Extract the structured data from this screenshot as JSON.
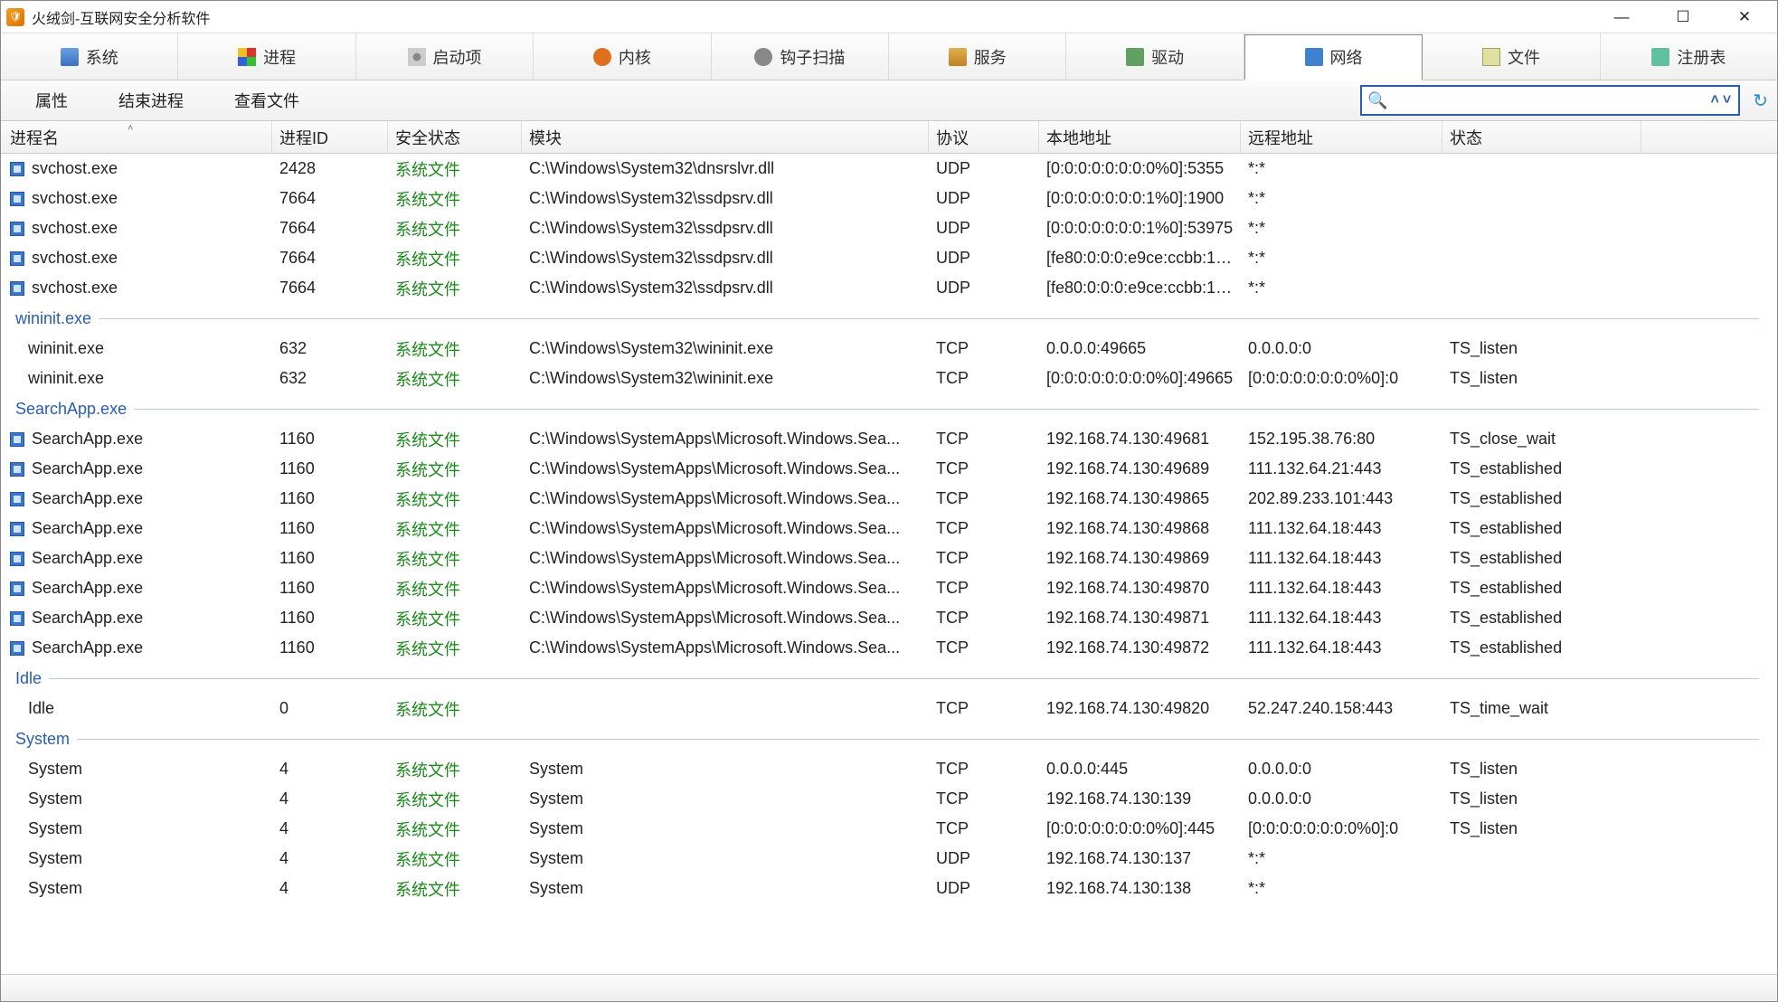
{
  "window": {
    "title": "火绒剑-互联网安全分析软件"
  },
  "menubar": {
    "tabs": [
      {
        "label": "系统",
        "icon": "mi-sys"
      },
      {
        "label": "进程",
        "icon": "mi-proc"
      },
      {
        "label": "启动项",
        "icon": "mi-start"
      },
      {
        "label": "内核",
        "icon": "mi-kernel"
      },
      {
        "label": "钩子扫描",
        "icon": "mi-hook"
      },
      {
        "label": "服务",
        "icon": "mi-svc"
      },
      {
        "label": "驱动",
        "icon": "mi-drv"
      },
      {
        "label": "网络",
        "icon": "mi-net",
        "active": true
      },
      {
        "label": "文件",
        "icon": "mi-file"
      },
      {
        "label": "注册表",
        "icon": "mi-reg"
      }
    ]
  },
  "toolbar": {
    "buttons": [
      "属性",
      "结束进程",
      "查看文件"
    ],
    "search_value": ""
  },
  "columns": [
    "进程名",
    "进程ID",
    "安全状态",
    "模块",
    "协议",
    "本地地址",
    "远程地址",
    "状态"
  ],
  "rows": [
    {
      "type": "row",
      "indent": false,
      "proc": "svchost.exe",
      "pid": "2428",
      "sec": "系统文件",
      "mod": "C:\\Windows\\System32\\dnsrslvr.dll",
      "proto": "UDP",
      "local": "[0:0:0:0:0:0:0:0%0]:5355",
      "remote": "*:*",
      "state": ""
    },
    {
      "type": "row",
      "indent": false,
      "proc": "svchost.exe",
      "pid": "7664",
      "sec": "系统文件",
      "mod": "C:\\Windows\\System32\\ssdpsrv.dll",
      "proto": "UDP",
      "local": "[0:0:0:0:0:0:0:1%0]:1900",
      "remote": "*:*",
      "state": ""
    },
    {
      "type": "row",
      "indent": false,
      "proc": "svchost.exe",
      "pid": "7664",
      "sec": "系统文件",
      "mod": "C:\\Windows\\System32\\ssdpsrv.dll",
      "proto": "UDP",
      "local": "[0:0:0:0:0:0:0:1%0]:53975",
      "remote": "*:*",
      "state": ""
    },
    {
      "type": "row",
      "indent": false,
      "proc": "svchost.exe",
      "pid": "7664",
      "sec": "系统文件",
      "mod": "C:\\Windows\\System32\\ssdpsrv.dll",
      "proto": "UDP",
      "local": "[fe80:0:0:0:e9ce:ccbb:1c...",
      "remote": "*:*",
      "state": ""
    },
    {
      "type": "row",
      "indent": false,
      "proc": "svchost.exe",
      "pid": "7664",
      "sec": "系统文件",
      "mod": "C:\\Windows\\System32\\ssdpsrv.dll",
      "proto": "UDP",
      "local": "[fe80:0:0:0:e9ce:ccbb:1c...",
      "remote": "*:*",
      "state": ""
    },
    {
      "type": "group",
      "label": "wininit.exe"
    },
    {
      "type": "row",
      "indent": true,
      "proc": "wininit.exe",
      "pid": "632",
      "sec": "系统文件",
      "mod": "C:\\Windows\\System32\\wininit.exe",
      "proto": "TCP",
      "local": "0.0.0.0:49665",
      "remote": "0.0.0.0:0",
      "state": "TS_listen"
    },
    {
      "type": "row",
      "indent": true,
      "proc": "wininit.exe",
      "pid": "632",
      "sec": "系统文件",
      "mod": "C:\\Windows\\System32\\wininit.exe",
      "proto": "TCP",
      "local": "[0:0:0:0:0:0:0:0%0]:49665",
      "remote": "[0:0:0:0:0:0:0:0%0]:0",
      "state": "TS_listen"
    },
    {
      "type": "group",
      "label": "SearchApp.exe"
    },
    {
      "type": "row",
      "indent": false,
      "proc": "SearchApp.exe",
      "pid": "1160",
      "sec": "系统文件",
      "mod": "C:\\Windows\\SystemApps\\Microsoft.Windows.Sea...",
      "proto": "TCP",
      "local": "192.168.74.130:49681",
      "remote": "152.195.38.76:80",
      "state": "TS_close_wait"
    },
    {
      "type": "row",
      "indent": false,
      "proc": "SearchApp.exe",
      "pid": "1160",
      "sec": "系统文件",
      "mod": "C:\\Windows\\SystemApps\\Microsoft.Windows.Sea...",
      "proto": "TCP",
      "local": "192.168.74.130:49689",
      "remote": "111.132.64.21:443",
      "state": "TS_established"
    },
    {
      "type": "row",
      "indent": false,
      "proc": "SearchApp.exe",
      "pid": "1160",
      "sec": "系统文件",
      "mod": "C:\\Windows\\SystemApps\\Microsoft.Windows.Sea...",
      "proto": "TCP",
      "local": "192.168.74.130:49865",
      "remote": "202.89.233.101:443",
      "state": "TS_established"
    },
    {
      "type": "row",
      "indent": false,
      "proc": "SearchApp.exe",
      "pid": "1160",
      "sec": "系统文件",
      "mod": "C:\\Windows\\SystemApps\\Microsoft.Windows.Sea...",
      "proto": "TCP",
      "local": "192.168.74.130:49868",
      "remote": "111.132.64.18:443",
      "state": "TS_established"
    },
    {
      "type": "row",
      "indent": false,
      "proc": "SearchApp.exe",
      "pid": "1160",
      "sec": "系统文件",
      "mod": "C:\\Windows\\SystemApps\\Microsoft.Windows.Sea...",
      "proto": "TCP",
      "local": "192.168.74.130:49869",
      "remote": "111.132.64.18:443",
      "state": "TS_established"
    },
    {
      "type": "row",
      "indent": false,
      "proc": "SearchApp.exe",
      "pid": "1160",
      "sec": "系统文件",
      "mod": "C:\\Windows\\SystemApps\\Microsoft.Windows.Sea...",
      "proto": "TCP",
      "local": "192.168.74.130:49870",
      "remote": "111.132.64.18:443",
      "state": "TS_established"
    },
    {
      "type": "row",
      "indent": false,
      "proc": "SearchApp.exe",
      "pid": "1160",
      "sec": "系统文件",
      "mod": "C:\\Windows\\SystemApps\\Microsoft.Windows.Sea...",
      "proto": "TCP",
      "local": "192.168.74.130:49871",
      "remote": "111.132.64.18:443",
      "state": "TS_established"
    },
    {
      "type": "row",
      "indent": false,
      "proc": "SearchApp.exe",
      "pid": "1160",
      "sec": "系统文件",
      "mod": "C:\\Windows\\SystemApps\\Microsoft.Windows.Sea...",
      "proto": "TCP",
      "local": "192.168.74.130:49872",
      "remote": "111.132.64.18:443",
      "state": "TS_established"
    },
    {
      "type": "group",
      "label": "Idle"
    },
    {
      "type": "row",
      "indent": true,
      "proc": "Idle",
      "pid": "0",
      "sec": "系统文件",
      "mod": "",
      "proto": "TCP",
      "local": "192.168.74.130:49820",
      "remote": "52.247.240.158:443",
      "state": "TS_time_wait"
    },
    {
      "type": "group",
      "label": "System"
    },
    {
      "type": "row",
      "indent": true,
      "proc": "System",
      "pid": "4",
      "sec": "系统文件",
      "mod": "System",
      "proto": "TCP",
      "local": "0.0.0.0:445",
      "remote": "0.0.0.0:0",
      "state": "TS_listen"
    },
    {
      "type": "row",
      "indent": true,
      "proc": "System",
      "pid": "4",
      "sec": "系统文件",
      "mod": "System",
      "proto": "TCP",
      "local": "192.168.74.130:139",
      "remote": "0.0.0.0:0",
      "state": "TS_listen"
    },
    {
      "type": "row",
      "indent": true,
      "proc": "System",
      "pid": "4",
      "sec": "系统文件",
      "mod": "System",
      "proto": "TCP",
      "local": "[0:0:0:0:0:0:0:0%0]:445",
      "remote": "[0:0:0:0:0:0:0:0%0]:0",
      "state": "TS_listen"
    },
    {
      "type": "row",
      "indent": true,
      "proc": "System",
      "pid": "4",
      "sec": "系统文件",
      "mod": "System",
      "proto": "UDP",
      "local": "192.168.74.130:137",
      "remote": "*:*",
      "state": ""
    },
    {
      "type": "row",
      "indent": true,
      "proc": "System",
      "pid": "4",
      "sec": "系统文件",
      "mod": "System",
      "proto": "UDP",
      "local": "192.168.74.130:138",
      "remote": "*:*",
      "state": ""
    }
  ]
}
